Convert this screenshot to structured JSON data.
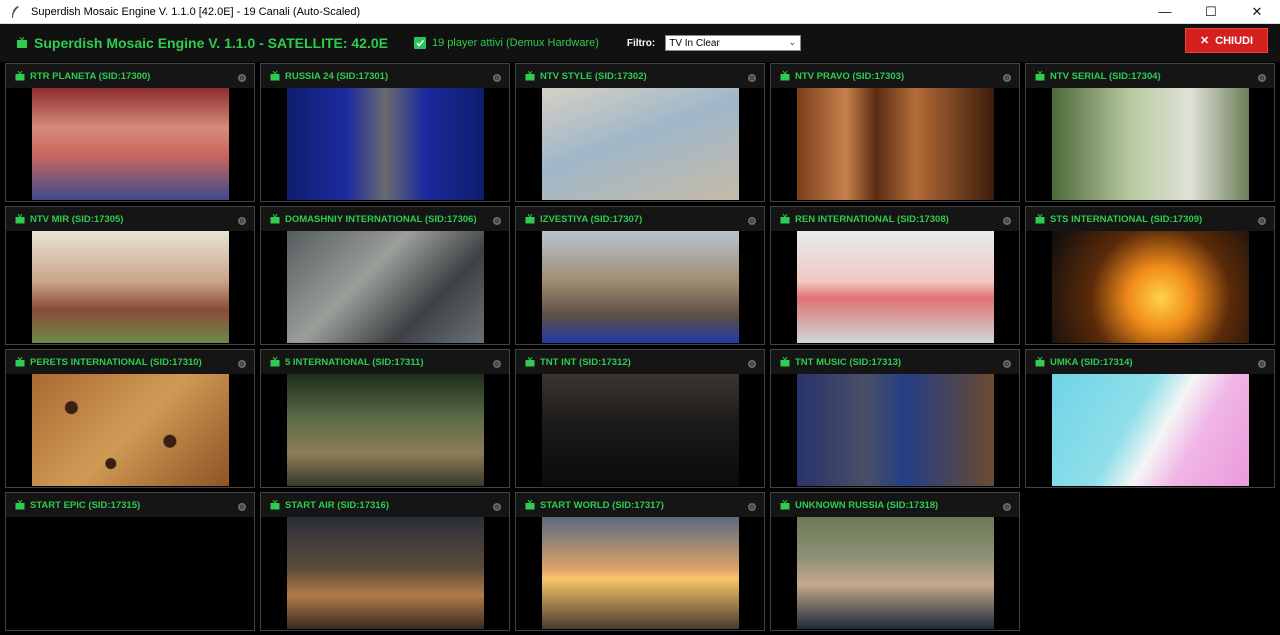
{
  "window": {
    "title": "Superdish Mosaic Engine V. 1.1.0 [42.0E] - 19 Canali (Auto-Scaled)",
    "minimize": "—",
    "maximize": "☐",
    "close": "✕"
  },
  "toolbar": {
    "brand": "Superdish Mosaic Engine V. 1.1.0 - SATELLITE: 42.0E",
    "players": "19 player attivi (Demux Hardware)",
    "filter_label": "Filtro:",
    "filter_value": "TV In Clear",
    "close_label": "CHIUDI"
  },
  "colors": {
    "accent_green": "#2ecc50",
    "close_red": "#d52020"
  },
  "channels": [
    {
      "label": "RTR PLANETA (SID:17300)",
      "scene": "studio"
    },
    {
      "label": "RUSSIA 24 (SID:17301)",
      "scene": "news"
    },
    {
      "label": "NTV STYLE (SID:17302)",
      "scene": "interior"
    },
    {
      "label": "NTV PRAVO (SID:17303)",
      "scene": "bars"
    },
    {
      "label": "NTV SERIAL (SID:17304)",
      "scene": "drama"
    },
    {
      "label": "NTV MIR (SID:17305)",
      "scene": "cooking"
    },
    {
      "label": "DOMASHNIY INTERNATIONAL (SID:17306)",
      "scene": "office"
    },
    {
      "label": "IZVESTIYA (SID:17307)",
      "scene": "city"
    },
    {
      "label": "REN INTERNATIONAL (SID:17308)",
      "scene": "food"
    },
    {
      "label": "STS INTERNATIONAL (SID:17309)",
      "scene": "fire"
    },
    {
      "label": "PERETS INTERNATIONAL (SID:17310)",
      "scene": "leopard"
    },
    {
      "label": "5 INTERNATIONAL (SID:17311)",
      "scene": "forest"
    },
    {
      "label": "TNT INT (SID:17312)",
      "scene": "dark"
    },
    {
      "label": "TNT MUSIC (SID:17313)",
      "scene": "shop"
    },
    {
      "label": "UMKA (SID:17314)",
      "scene": "cartoon"
    },
    {
      "label": "START EPIC (SID:17315)",
      "scene": "black"
    },
    {
      "label": "START AIR (SID:17316)",
      "scene": "bar"
    },
    {
      "label": "START WORLD (SID:17317)",
      "scene": "sunset"
    },
    {
      "label": "UNKNOWN RUSSIA (SID:17318)",
      "scene": "portrait"
    }
  ]
}
